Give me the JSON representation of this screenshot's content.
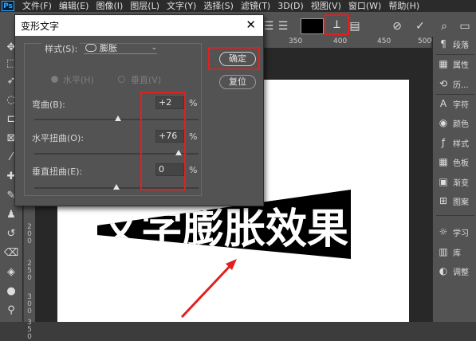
{
  "menu": [
    "文件(F)",
    "编辑(E)",
    "图像(I)",
    "图层(L)",
    "文字(Y)",
    "选择(S)",
    "滤镜(T)",
    "3D(D)",
    "视图(V)",
    "窗口(W)",
    "帮助(H)"
  ],
  "app_logo": "Ps",
  "ruler_ticks": [
    "350",
    "400",
    "450",
    "500"
  ],
  "ruler_v": [
    "200",
    "250",
    "300",
    "350"
  ],
  "dialog": {
    "title": "变形文字",
    "style_label": "样式(S):",
    "style_value": "膨胀",
    "horizontal_label": "水平(H)",
    "vertical_label": "垂直(V)",
    "bend_label": "弯曲(B):",
    "bend_value": "+2",
    "h_distort_label": "水平扭曲(O):",
    "h_distort_value": "+76",
    "v_distort_label": "垂直扭曲(E):",
    "v_distort_value": "0",
    "percent": "%",
    "ok_label": "确定",
    "reset_label": "复位"
  },
  "slider_levels": {
    "bend": 2,
    "h_distort": 76,
    "v_distort": 0
  },
  "canvas_text": "文字膨胀效果",
  "right_panel": [
    "段落",
    "属性",
    "历...",
    "字符",
    "颜色",
    "样式",
    "色板",
    "渐变",
    "图案",
    "学习",
    "库",
    "调整"
  ],
  "colors": {
    "highlight": "#e02020",
    "text_color_swatch": "#000000"
  }
}
